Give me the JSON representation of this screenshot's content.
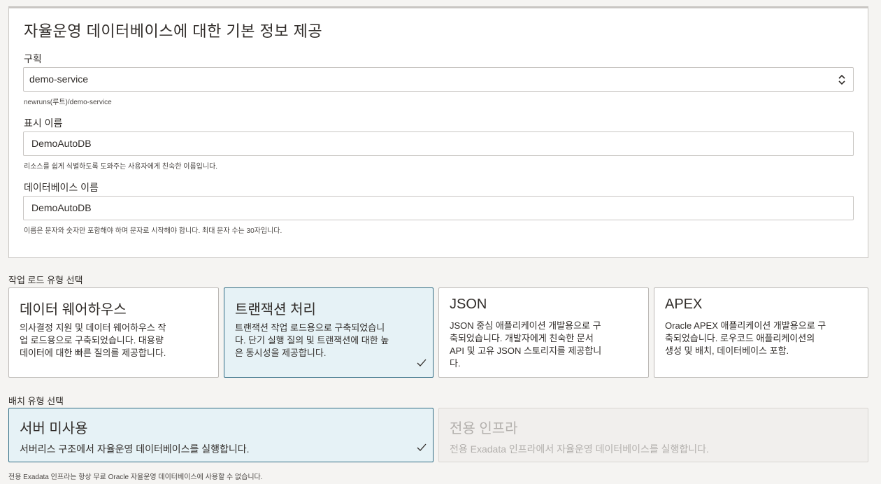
{
  "basic_info": {
    "title": "자율운영 데이터베이스에 대한 기본 정보 제공",
    "compartment": {
      "label": "구획",
      "value": "demo-service",
      "path": "newruns(루트)/demo-service"
    },
    "display_name": {
      "label": "표시 이름",
      "value": "DemoAutoDB",
      "help": "리소스를 쉽게 식별하도록 도와주는 사용자에게 친숙한 이름입니다."
    },
    "db_name": {
      "label": "데이터베이스 이름",
      "value": "DemoAutoDB",
      "help": "이름은 문자와 숫자만 포함해야 하며 문자로 시작해야 합니다. 최대 문자 수는 30자입니다."
    }
  },
  "workload": {
    "label": "작업 로드 유형 선택",
    "options": [
      {
        "title": "데이터 웨어하우스",
        "desc_lines": [
          "의사결정 지원 및 데이터 웨어하우스 작",
          "업 로드용으로 구축되었습니다. 대용량",
          "데이터에 대한 빠른 질의를 제공합니다."
        ],
        "selected": false
      },
      {
        "title": "트랜잭션 처리",
        "desc_lines": [
          "트랜잭션 작업 로드용으로 구축되었습니",
          "다. 단기 실행 질의 및 트랜잭션에 대한 높",
          "은 동시성을 제공합니다."
        ],
        "selected": true
      },
      {
        "title": "JSON",
        "desc_lines": [
          "JSON 중심 애플리케이션 개발용으로 구",
          "축되었습니다. 개발자에게 친숙한 문서",
          "API 및 고유 JSON 스토리지를 제공합니",
          "다."
        ],
        "selected": false
      },
      {
        "title": "APEX",
        "desc_lines": [
          "Oracle APEX 애플리케이션 개발용으로 구",
          "축되었습니다. 로우코드 애플리케이션의",
          "생성 및 배치, 데이터베이스 포함."
        ],
        "selected": false
      }
    ]
  },
  "deployment": {
    "label": "배치 유형 선택",
    "options": [
      {
        "title": "서버 미사용",
        "desc": "서버리스 구조에서 자율운영 데이터베이스를 실행합니다.",
        "selected": true,
        "disabled": false
      },
      {
        "title": "전용 인프라",
        "desc": "전용 Exadata 인프라에서 자율운영 데이터베이스를 실행합니다.",
        "selected": false,
        "disabled": true
      }
    ],
    "note": "전용 Exadata 인프라는 항상 무료 Oracle 자율운영 데이터베이스에 사용할 수 없습니다."
  },
  "icons": {
    "select": "chevron-up-down-icon",
    "check": "checkmark-icon"
  },
  "colors": {
    "selected_bg": "#e6f2f6",
    "selected_border": "#2f6c84"
  }
}
